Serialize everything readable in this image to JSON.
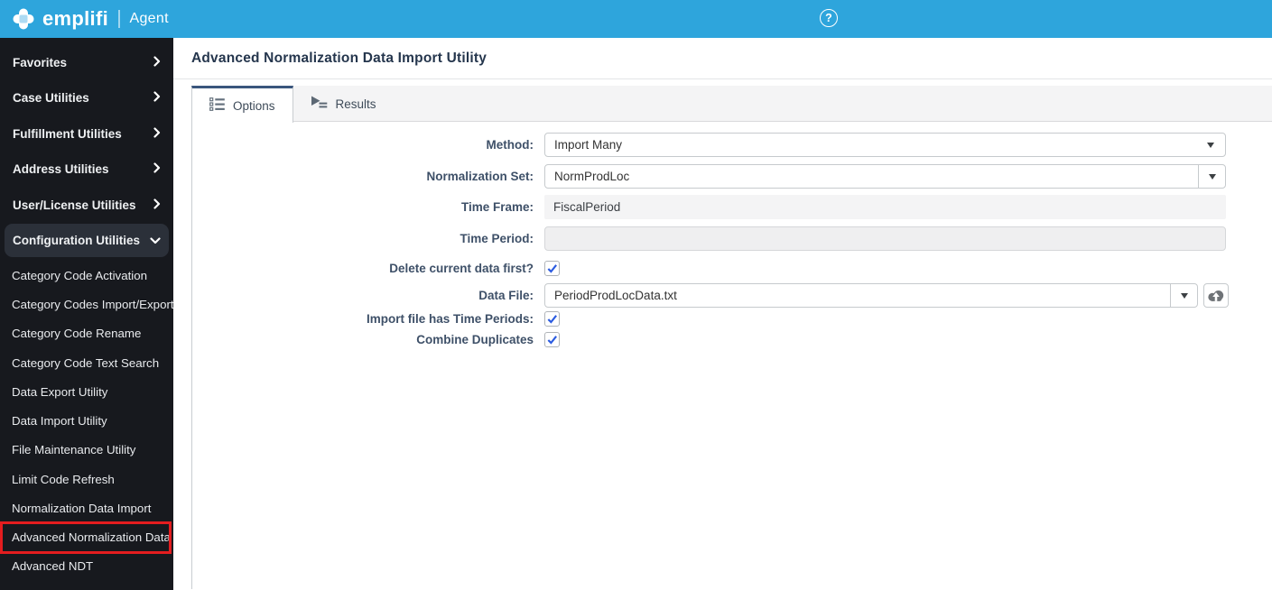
{
  "header": {
    "brand": "emplifi",
    "product": "Agent",
    "help_glyph": "?"
  },
  "sidebar": {
    "top_items": [
      {
        "label": "Favorites",
        "chevron": "right",
        "expanded": false
      },
      {
        "label": "Case Utilities",
        "chevron": "right",
        "expanded": false
      },
      {
        "label": "Fulfillment Utilities",
        "chevron": "right",
        "expanded": false
      },
      {
        "label": "Address Utilities",
        "chevron": "right",
        "expanded": false
      },
      {
        "label": "User/License Utilities",
        "chevron": "right",
        "expanded": false
      },
      {
        "label": "Configuration Utilities",
        "chevron": "down",
        "expanded": true
      }
    ],
    "sub_items": [
      {
        "label": "Category Code Activation",
        "highlighted": false
      },
      {
        "label": "Category Codes Import/Export",
        "highlighted": false
      },
      {
        "label": "Category Code Rename",
        "highlighted": false
      },
      {
        "label": "Category Code Text Search",
        "highlighted": false
      },
      {
        "label": "Data Export Utility",
        "highlighted": false
      },
      {
        "label": "Data Import Utility",
        "highlighted": false
      },
      {
        "label": "File Maintenance Utility",
        "highlighted": false
      },
      {
        "label": "Limit Code Refresh",
        "highlighted": false
      },
      {
        "label": "Normalization Data Import",
        "highlighted": false
      },
      {
        "label": "Advanced Normalization Data",
        "highlighted": true
      },
      {
        "label": "Advanced NDT",
        "highlighted": false
      }
    ]
  },
  "page": {
    "title": "Advanced Normalization Data Import Utility"
  },
  "tabs": [
    {
      "label": "Options",
      "active": true,
      "icon": "list-options-icon"
    },
    {
      "label": "Results",
      "active": false,
      "icon": "play-results-icon"
    }
  ],
  "form": {
    "fields": [
      {
        "label": "Method:",
        "type": "select",
        "value": "Import Many"
      },
      {
        "label": "Normalization Set:",
        "type": "combobox",
        "value": "NormProdLoc"
      },
      {
        "label": "Time Frame:",
        "type": "readonly",
        "value": "FiscalPeriod"
      },
      {
        "label": "Time Period:",
        "type": "readonly",
        "value": ""
      },
      {
        "label": "Delete current data first?",
        "type": "checkbox",
        "checked": true
      },
      {
        "label": "Data File:",
        "type": "combobox-upload",
        "value": "PeriodProdLocData.txt"
      },
      {
        "label": "Import file has Time Periods:",
        "type": "checkbox",
        "checked": true
      },
      {
        "label": "Combine Duplicates",
        "type": "checkbox",
        "checked": true
      }
    ]
  },
  "colors": {
    "header_blue": "#2ea5dc",
    "sidebar_bg": "#17191e",
    "sidebar_highlight": "#2b3039",
    "annotation_red": "#e41d1f",
    "active_tab_border": "#3a567d",
    "check_blue": "#2b5be0"
  }
}
